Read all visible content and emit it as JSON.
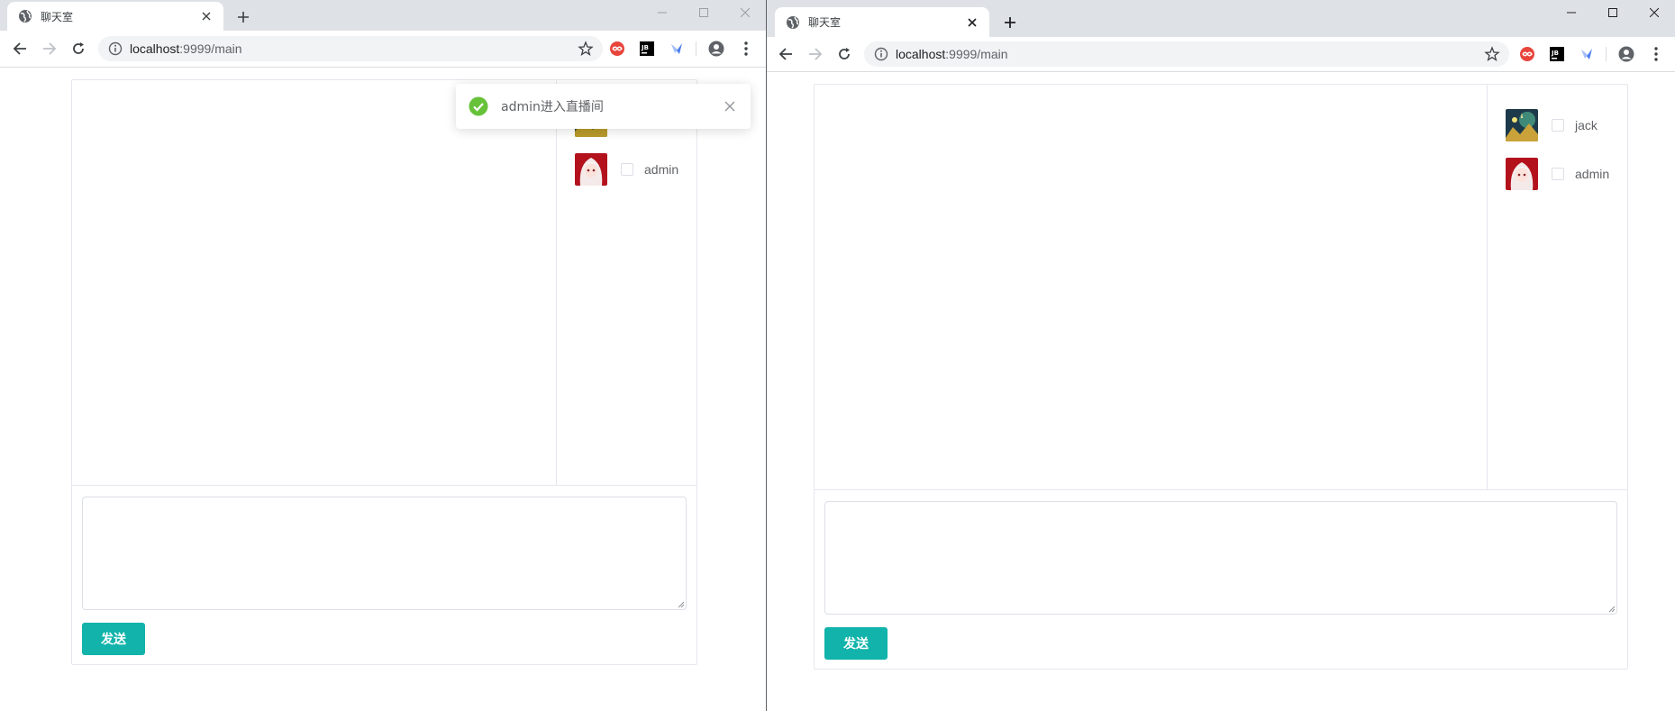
{
  "windows": [
    {
      "id": "left",
      "tab_title": "聊天室",
      "url_host": "localhost",
      "url_rest": ":9999/main",
      "users": [
        {
          "name": "",
          "avatar": "forest-avatar"
        },
        {
          "name": "admin",
          "avatar": "anime-girl-avatar"
        }
      ],
      "send_label": "发送",
      "message_value": "",
      "toast": {
        "text": "admin进入直播间",
        "icon": "success-check-icon"
      }
    },
    {
      "id": "right",
      "tab_title": "聊天室",
      "url_host": "localhost",
      "url_rest": ":9999/main",
      "users": [
        {
          "name": "jack",
          "avatar": "forest-avatar"
        },
        {
          "name": "admin",
          "avatar": "anime-girl-avatar"
        }
      ],
      "send_label": "发送",
      "message_value": ""
    }
  ],
  "colors": {
    "accent": "#11b3aa",
    "success": "#67c23a",
    "tabstrip": "#dee1e6",
    "border": "#e4e7ed"
  },
  "icons": [
    "globe-icon",
    "close-icon",
    "plus-icon",
    "minimize-icon",
    "maximize-icon",
    "back-icon",
    "forward-icon",
    "reload-icon",
    "info-icon",
    "star-icon",
    "profile-icon",
    "menu-icon"
  ]
}
